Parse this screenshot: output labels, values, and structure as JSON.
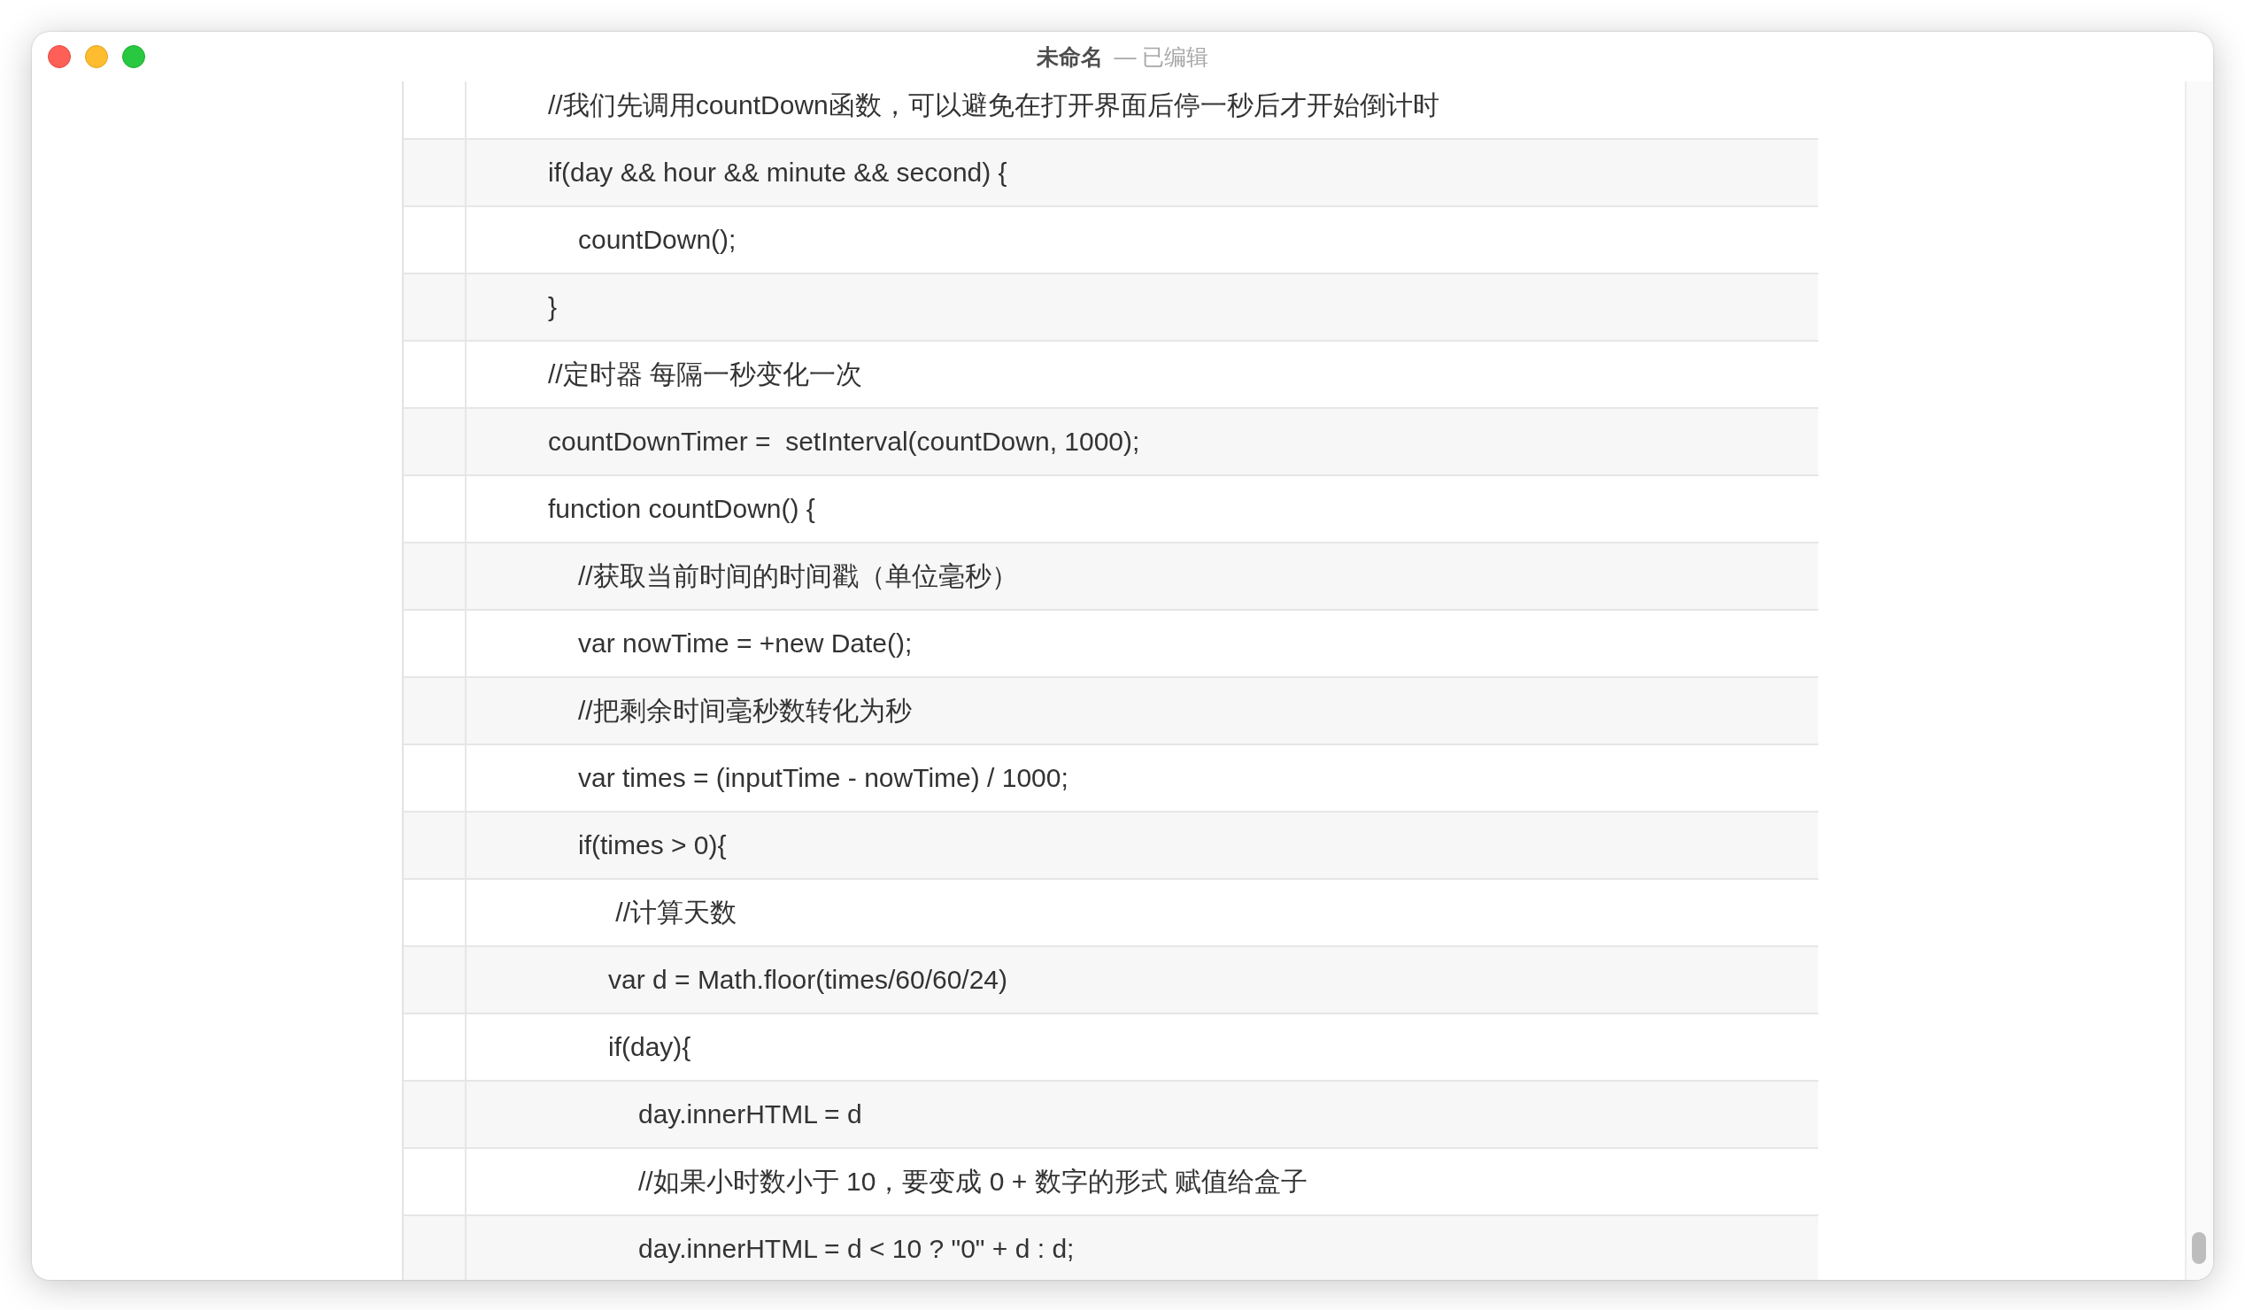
{
  "window": {
    "title": "未命名",
    "subtitle": "— 已编辑"
  },
  "lines": [
    {
      "text": "//我们先调用countDown函数，可以避免在打开界面后停一秒后才开始倒计时"
    },
    {
      "text": "if(day && hour && minute && second) {",
      "children": [
        {
          "text": "countDown();"
        }
      ]
    },
    {
      "text": "}"
    },
    {
      "text": "//定时器 每隔一秒变化一次"
    },
    {
      "text": "countDownTimer =  setInterval(countDown, 1000);"
    },
    {
      "text": "function countDown() {",
      "children": [
        {
          "text": "//获取当前时间的时间戳（单位毫秒）"
        },
        {
          "text": "var nowTime = +new Date();"
        },
        {
          "text": "//把剩余时间毫秒数转化为秒"
        },
        {
          "text": "var times = (inputTime - nowTime) / 1000;"
        },
        {
          "text": "if(times > 0){",
          "children": [
            {
              "text": " //计算天数"
            },
            {
              "text": "var d = Math.floor(times/60/60/24)"
            },
            {
              "text": "if(day){",
              "children": [
                {
                  "text": "day.innerHTML = d"
                },
                {
                  "text": "//如果小时数小于 10，要变成 0 + 数字的形式 赋值给盒子"
                },
                {
                  "text": "day.innerHTML = d < 10 ? \"0\" + d : d;"
                }
              ]
            }
          ]
        }
      ]
    }
  ]
}
